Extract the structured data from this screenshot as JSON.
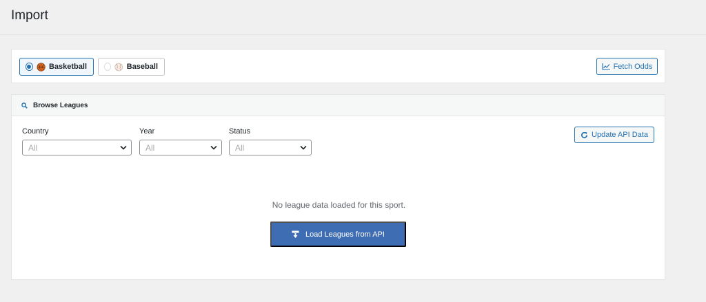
{
  "page": {
    "title": "Import"
  },
  "sports": {
    "options": [
      {
        "label": "Basketball",
        "selected": true,
        "icon": "basketball-icon"
      },
      {
        "label": "Baseball",
        "selected": false,
        "icon": "baseball-icon"
      }
    ]
  },
  "toolbar": {
    "fetch_odds_label": "Fetch Odds",
    "fetch_odds_icon": "chart-line-icon"
  },
  "browse": {
    "header": "Browse Leagues",
    "header_icon": "search-icon",
    "filters": {
      "country": {
        "label": "Country",
        "value": "All"
      },
      "year": {
        "label": "Year",
        "value": "All"
      },
      "status": {
        "label": "Status",
        "value": "All"
      }
    },
    "update_label": "Update API Data",
    "update_icon": "refresh-icon",
    "empty_message": "No league data loaded for this sport.",
    "load_label": "Load Leagues from API",
    "load_icon": "download-icon"
  },
  "colors": {
    "accent": "#2271b1",
    "primary_button": "#3f6db3",
    "background": "#f0f0f1",
    "basketball": "#e06b1f"
  }
}
